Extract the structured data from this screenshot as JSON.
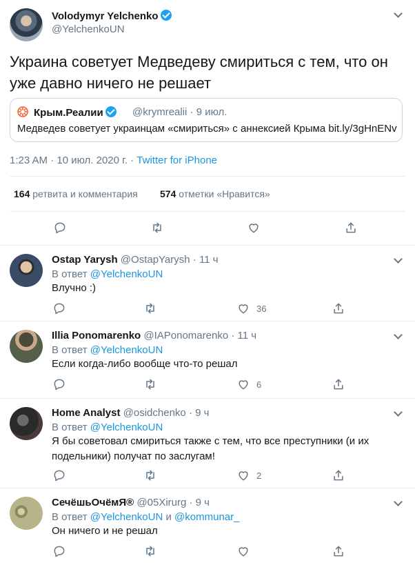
{
  "main_tweet": {
    "author_name": "Volodymyr Yelchenko",
    "author_handle": "@YelchenkoUN",
    "text": "Украина советует Медведеву смириться с тем, что он уже давно ничего не решает",
    "quote": {
      "name": "Крым.Реалии",
      "handle": "@krymrealii",
      "date": "· 9 июл.",
      "text": "Медведев советует украинцам «смириться» с аннексией Крыма bit.ly/3gHnENv"
    },
    "timestamp": "1:23 AM · 10 июл. 2020 г. · ",
    "source": "Twitter for iPhone",
    "retweets_count": "164",
    "retweets_label": "ретвита и комментария",
    "likes_count": "574",
    "likes_label": "отметки «Нравится»"
  },
  "replies": [
    {
      "name": "Ostap Yarysh",
      "handle": "@OstapYarysh",
      "time": " · 11 ч",
      "reply_label": "В ответ ",
      "reply_to": "@YelchenkoUN",
      "text": "Влучно :)",
      "likes": "36"
    },
    {
      "name": "Illia Ponomarenko",
      "handle": "@IAPonomarenko",
      "time": " · 11 ч",
      "reply_label": "В ответ ",
      "reply_to": "@YelchenkoUN",
      "text": "Если когда-либо вообще что-то решал",
      "likes": "6"
    },
    {
      "name": "Home Analyst",
      "handle": "@osidchenko",
      "time": " · 9 ч",
      "reply_label": "В ответ ",
      "reply_to": "@YelchenkoUN",
      "text": "Я бы советовал смириться также с тем, что все преступники (и их подельники) получат по заслугам!",
      "likes": "2"
    },
    {
      "name": "СечёшьОчёмЯ®",
      "handle": "@05Xirurg",
      "time": " · 9 ч",
      "reply_label": "В ответ ",
      "reply_to": "@YelchenkoUN",
      "reply_and": " и ",
      "reply_to_2": "@kommunar_",
      "text": "Он ничего и не решал"
    }
  ],
  "icons": {
    "reply": "reply-icon",
    "retweet": "retweet-icon",
    "like": "heart-icon",
    "share": "share-icon",
    "more": "chevron-down-icon"
  },
  "colors": {
    "accent": "#1b95e0",
    "verified": "#1da1f2",
    "secondary_text": "#657786",
    "border": "#e6ecf0",
    "quote_logo": "#f15a22"
  }
}
